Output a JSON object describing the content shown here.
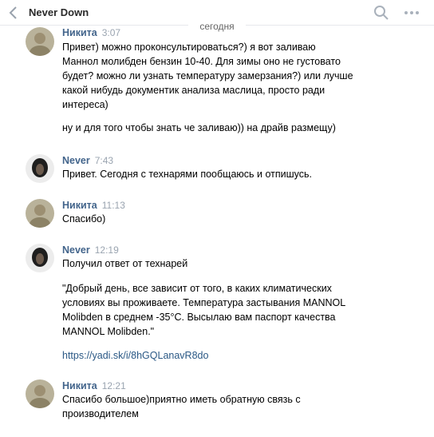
{
  "header": {
    "title": "Never Down"
  },
  "date_separator": "сегодня",
  "messages": [
    {
      "name": "Никита",
      "time": "3:07",
      "paragraphs": [
        "Привет) можно проконсультироваться?) я вот заливаю\nМаннол молибден бензин 10-40. Для зимы оно не густовато\nбудет? можно ли узнать температуру замерзания?) или лучше\nкакой нибудь документик анализа маслица, просто ради\nинтереса)",
        "ну и для того чтобы знать че заливаю)) на драйв размещу)"
      ]
    },
    {
      "name": "Never",
      "time": "7:43",
      "paragraphs": [
        "Привет. Сегодня с технарями пообщаюсь и отпишусь."
      ]
    },
    {
      "name": "Никита",
      "time": "11:13",
      "paragraphs": [
        "Спасибо)"
      ]
    },
    {
      "name": "Never",
      "time": "12:19",
      "paragraphs": [
        "Получил ответ от технарей",
        "\"Добрый день, все зависит от того, в каких климатических\nусловиях вы проживаете. Температура застывания MANNOL\nMolibden в среднем -35°С. Высылаю вам паспорт качества\nMANNOL Molibden.\""
      ],
      "link": "https://yadi.sk/i/8hGQLanavR8do"
    },
    {
      "name": "Никита",
      "time": "12:21",
      "paragraphs": [
        "Спасибо большое)приятно иметь обратную связь с\nпроизводителем"
      ]
    }
  ]
}
